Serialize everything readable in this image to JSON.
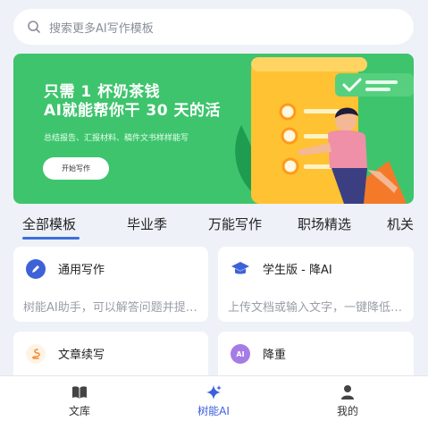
{
  "search": {
    "placeholder": "搜索更多AI写作模板"
  },
  "banner": {
    "headline": "只需 1 杯奶茶钱\nAI就能帮你干 30 天的活",
    "subline": "总结报告、汇报材料、稿件文书样样能写",
    "cta": "开始写作"
  },
  "tabs": [
    "全部模板",
    "毕业季",
    "万能写作",
    "职场精选",
    "机关"
  ],
  "cards": [
    {
      "title": "通用写作",
      "desc": "树能AI助手，可以解答问题并提供帮助",
      "icon": "pen-icon",
      "color": "#3d62d8"
    },
    {
      "title": "学生版 - 降AI",
      "desc": "上传文档或输入文字，一键降低AI率",
      "icon": "graduation-cap-icon",
      "color": "#3d62d8"
    },
    {
      "title": "文章续写",
      "desc": "",
      "icon": "ribbon-icon",
      "color": "#f08a2e"
    },
    {
      "title": "降重",
      "desc": "",
      "icon": "ai-badge-icon",
      "color": "#a77be6"
    }
  ],
  "nav": [
    {
      "label": "文库",
      "icon": "book-icon"
    },
    {
      "label": "树能AI",
      "icon": "sparkle-icon"
    },
    {
      "label": "我的",
      "icon": "person-icon"
    }
  ],
  "colors": {
    "accent": "#3c6fdc",
    "banner": "#3ec46d",
    "background": "#eef1f8"
  }
}
